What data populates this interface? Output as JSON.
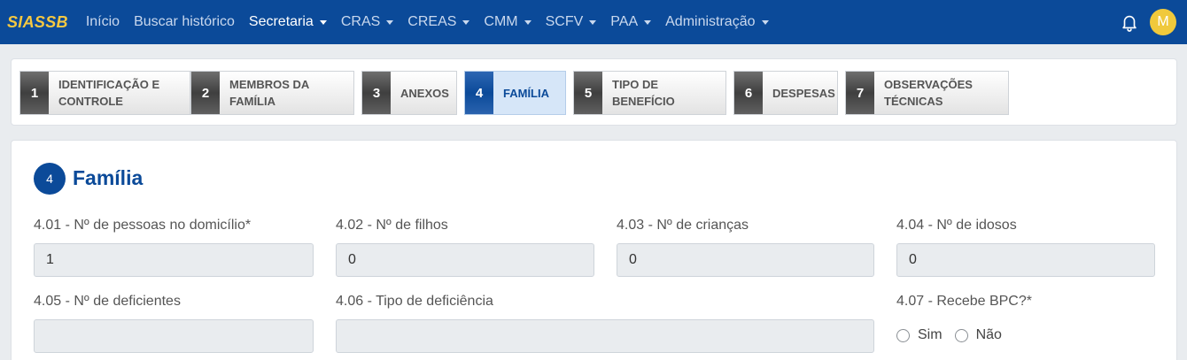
{
  "navbar": {
    "brand": "SIASSB",
    "items": [
      {
        "label": "Início",
        "dropdown": false,
        "active": false
      },
      {
        "label": "Buscar histórico",
        "dropdown": false,
        "active": false
      },
      {
        "label": "Secretaria",
        "dropdown": true,
        "active": true
      },
      {
        "label": "CRAS",
        "dropdown": true,
        "active": false
      },
      {
        "label": "CREAS",
        "dropdown": true,
        "active": false
      },
      {
        "label": "CMM",
        "dropdown": true,
        "active": false
      },
      {
        "label": "SCFV",
        "dropdown": true,
        "active": false
      },
      {
        "label": "PAA",
        "dropdown": true,
        "active": false
      },
      {
        "label": "Administração",
        "dropdown": true,
        "active": false
      }
    ],
    "notification_icon": "bell-icon",
    "avatar_initial": "M"
  },
  "steps": [
    {
      "num": "1",
      "label": "IDENTIFICAÇÃO E CONTROLE"
    },
    {
      "num": "2",
      "label": "MEMBROS DA FAMÍLIA"
    },
    {
      "num": "3",
      "label": "ANEXOS"
    },
    {
      "num": "4",
      "label": "FAMÍLIA",
      "active": true
    },
    {
      "num": "5",
      "label": "TIPO DE BENEFÍCIO"
    },
    {
      "num": "6",
      "label": "DESPESAS"
    },
    {
      "num": "7",
      "label": "OBSERVAÇÕES TÉCNICAS"
    }
  ],
  "section": {
    "number": "4",
    "title": "Família"
  },
  "fields": {
    "f401": {
      "label": "4.01 - Nº de pessoas no domicílio*",
      "value": "1"
    },
    "f402": {
      "label": "4.02 - Nº de filhos",
      "value": "0"
    },
    "f403": {
      "label": "4.03 - Nº de crianças",
      "value": "0"
    },
    "f404": {
      "label": "4.04 - Nº de idosos",
      "value": "0"
    },
    "f405": {
      "label": "4.05 - Nº de deficientes",
      "value": ""
    },
    "f406": {
      "label": "4.06 - Tipo de deficiência",
      "value": ""
    },
    "f407": {
      "label": "4.07 - Recebe BPC?*",
      "options": [
        "Sim",
        "Não"
      ]
    }
  },
  "colors": {
    "primary": "#0b4a99",
    "brand": "#f5c842",
    "avatar": "#f0c93c"
  }
}
